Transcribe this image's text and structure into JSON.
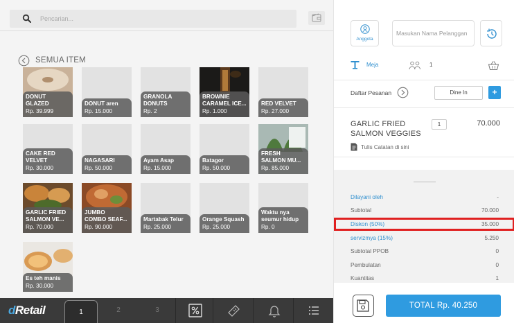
{
  "search": {
    "placeholder": "Pencarian..."
  },
  "catalog": {
    "back_label": "SEMUA ITEM",
    "items": [
      {
        "name": "DONUT\nGLAZED",
        "price": "Rp. 39.999",
        "image": "donut"
      },
      {
        "name": "DONUT aren",
        "price": "Rp. 15.000",
        "image": ""
      },
      {
        "name": "GRANOLA\nDONUTS",
        "price": "Rp. 2",
        "image": ""
      },
      {
        "name": "BROWNIE\nCARAMEL ICE...",
        "price": "Rp. 1.000",
        "image": "drink-dark"
      },
      {
        "name": "RED VELVET",
        "price": "Rp. 27.000",
        "image": ""
      },
      {
        "name": "CAKE RED\nVELVET",
        "price": "Rp. 30.000",
        "image": ""
      },
      {
        "name": "NAGASARI",
        "price": "Rp. 50.000",
        "image": ""
      },
      {
        "name": "Ayam Asap",
        "price": "Rp. 15.000",
        "image": ""
      },
      {
        "name": "Batagor",
        "price": "Rp. 50.000",
        "image": ""
      },
      {
        "name": "FRESH\nSALMON MU...",
        "price": "Rp. 85.000",
        "image": "plant"
      },
      {
        "name": "GARLIC FRIED\nSALMON  VE...",
        "price": "Rp. 70.000",
        "image": "salmon"
      },
      {
        "name": "JUMBO\nCOMBO SEAF...",
        "price": "Rp. 90.000",
        "image": "seafood"
      },
      {
        "name": "Martabak Telur",
        "price": "Rp. 25.000",
        "image": ""
      },
      {
        "name": "Orange Squash",
        "price": "Rp. 25.000",
        "image": ""
      },
      {
        "name": "Waktu nya\nseumur hidup",
        "price": "Rp. 0",
        "image": ""
      },
      {
        "name": "Es teh manis",
        "price": "Rp. 30.000",
        "image": "tea"
      }
    ]
  },
  "bottom_nav": {
    "logo_d": "d",
    "logo_rest": "Retail",
    "pages": [
      "1",
      "2",
      "3"
    ],
    "icons": [
      "percent-icon",
      "ticket-icon",
      "bell-icon",
      "list-icon"
    ]
  },
  "customer": {
    "member_label": "Anggota",
    "name_placeholder": "Masukan Nama Pelanggan"
  },
  "table": {
    "label": "Meja",
    "guests": "1"
  },
  "order": {
    "label": "Daftar Pesanan",
    "mode": "Dine In",
    "add_label": "+"
  },
  "cart": {
    "items": [
      {
        "name": "GARLIC FRIED SALMON  VEGGIES",
        "qty": "1",
        "price": "70.000",
        "note_label": "Tulis Catatan di sini"
      }
    ]
  },
  "summary": {
    "rows": [
      {
        "label": "Dilayani oleh",
        "value": "-"
      },
      {
        "label": "Subtotal",
        "value": "70.000"
      },
      {
        "label": "Diskon (50%)",
        "value": "35.000"
      },
      {
        "label": "servizmya (15%)",
        "value": "5.250"
      },
      {
        "label": "Subtotal PPOB",
        "value": "0"
      },
      {
        "label": "Pembulatan",
        "value": "0"
      },
      {
        "label": "Kuantitas",
        "value": "1"
      }
    ]
  },
  "footer": {
    "total_label": "TOTAL Rp. 40.250"
  },
  "colors": {
    "accent": "#2f9be0",
    "link": "#2f8fcf",
    "highlight": "#e02020",
    "nav_bg": "#3a3a3a"
  }
}
